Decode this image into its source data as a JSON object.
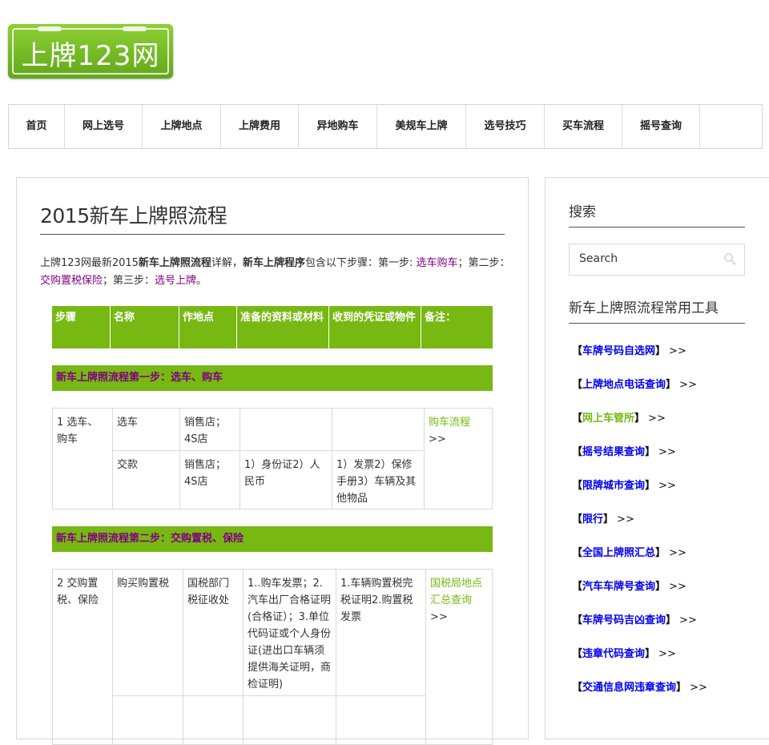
{
  "site": {
    "logo_text": "上牌123网"
  },
  "nav": [
    "首页",
    "网上选号",
    "上牌地点",
    "上牌费用",
    "异地购车",
    "美规车上牌",
    "选号技巧",
    "买车流程",
    "摇号查询"
  ],
  "article": {
    "title": "2015新车上牌照流程",
    "intro": {
      "p1": "上牌123网最新2015",
      "b1": "新车上牌照流程",
      "p2": "详解，",
      "b2": "新车上牌程序",
      "p3": "包含以下步骤：第一步: ",
      "l1": "选车购车",
      "p4": "；第二步：",
      "l2": "交购置税保险",
      "p5": "；第三步：",
      "l3": "选号上牌",
      "p6": "。"
    },
    "table_headers": [
      "步骤",
      "名称",
      "作地点",
      "准备的资料或材料",
      "收到的凭证或物件",
      "备注："
    ],
    "step1_title": "新车上牌照流程第一步：选车、购车",
    "step1": {
      "step": "1 选车、购车",
      "rows": [
        {
          "name": "选车",
          "place": "销售店；4S店",
          "docs": "",
          "receipts": ""
        },
        {
          "name": "交款",
          "place": "销售店；4S店",
          "docs": "1）身份证2）人民币",
          "receipts": "1）发票2）保修手册3）车辆及其他物品"
        }
      ],
      "note_link": "购车流程",
      "note_suffix": ">>"
    },
    "step2_title": "新车上牌照流程第二步：交购置税、保险",
    "step2": {
      "step": "2 交购置税、保险",
      "name": "购买购置税",
      "place": "国税部门税征收处",
      "docs": "1..购车发票；2.汽车出厂合格证明(合格证）；3.单位代码证或个人身份证(进出口车辆须提供海关证明，商检证明)",
      "receipts": "1.车辆购置税完税证明2.购置税发票",
      "note_link": "国税局地点汇总查询",
      "note_suffix": ">>"
    }
  },
  "sidebar": {
    "search_title": "搜索",
    "search_placeholder": "Search",
    "tools_title": "新车上牌照流程常用工具",
    "tools": [
      {
        "label": "车牌号码自选网",
        "green": false
      },
      {
        "label": "上牌地点电话查询",
        "green": false
      },
      {
        "label": "网上车管所",
        "green": true
      },
      {
        "label": "摇号结果查询",
        "green": false
      },
      {
        "label": "限牌城市查询",
        "green": false
      },
      {
        "label": "限行",
        "green": false
      },
      {
        "label": "全国上牌照汇总",
        "green": false
      },
      {
        "label": "汽车车牌号查询",
        "green": false
      },
      {
        "label": "车牌号码吉凶查询",
        "green": false
      },
      {
        "label": "违章代码查询",
        "green": false
      },
      {
        "label": "交通信息网违章查询",
        "green": false
      }
    ],
    "bracket_left": "【",
    "bracket_right": "】",
    "arrows": ">>"
  },
  "colors": {
    "brand_green": "#77b813",
    "link_purple": "#800080",
    "link_blue": "#0000ee"
  },
  "icons": {
    "search": "magnifier-icon"
  }
}
